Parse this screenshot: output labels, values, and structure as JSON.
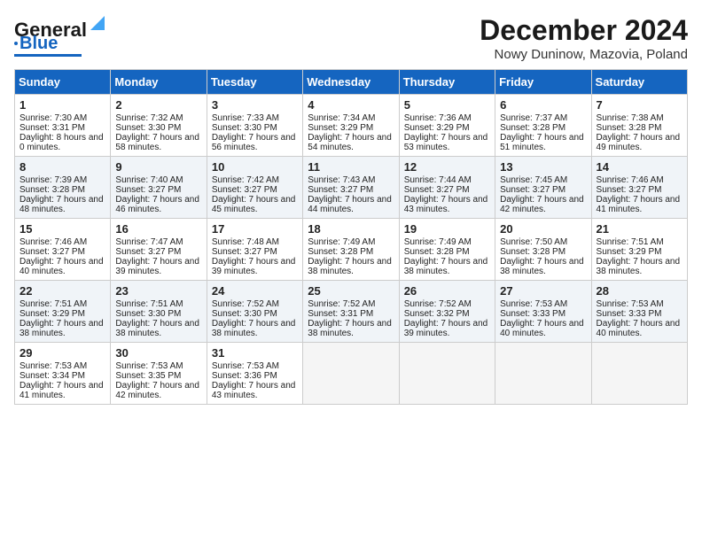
{
  "logo": {
    "line1": "General",
    "line2": "Blue"
  },
  "title": "December 2024",
  "location": "Nowy Duninow, Mazovia, Poland",
  "headers": [
    "Sunday",
    "Monday",
    "Tuesday",
    "Wednesday",
    "Thursday",
    "Friday",
    "Saturday"
  ],
  "weeks": [
    [
      {
        "num": "1",
        "sr": "7:30 AM",
        "ss": "3:31 PM",
        "dl": "8 hours and 0 minutes."
      },
      {
        "num": "2",
        "sr": "7:32 AM",
        "ss": "3:30 PM",
        "dl": "7 hours and 58 minutes."
      },
      {
        "num": "3",
        "sr": "7:33 AM",
        "ss": "3:30 PM",
        "dl": "7 hours and 56 minutes."
      },
      {
        "num": "4",
        "sr": "7:34 AM",
        "ss": "3:29 PM",
        "dl": "7 hours and 54 minutes."
      },
      {
        "num": "5",
        "sr": "7:36 AM",
        "ss": "3:29 PM",
        "dl": "7 hours and 53 minutes."
      },
      {
        "num": "6",
        "sr": "7:37 AM",
        "ss": "3:28 PM",
        "dl": "7 hours and 51 minutes."
      },
      {
        "num": "7",
        "sr": "7:38 AM",
        "ss": "3:28 PM",
        "dl": "7 hours and 49 minutes."
      }
    ],
    [
      {
        "num": "8",
        "sr": "7:39 AM",
        "ss": "3:28 PM",
        "dl": "7 hours and 48 minutes."
      },
      {
        "num": "9",
        "sr": "7:40 AM",
        "ss": "3:27 PM",
        "dl": "7 hours and 46 minutes."
      },
      {
        "num": "10",
        "sr": "7:42 AM",
        "ss": "3:27 PM",
        "dl": "7 hours and 45 minutes."
      },
      {
        "num": "11",
        "sr": "7:43 AM",
        "ss": "3:27 PM",
        "dl": "7 hours and 44 minutes."
      },
      {
        "num": "12",
        "sr": "7:44 AM",
        "ss": "3:27 PM",
        "dl": "7 hours and 43 minutes."
      },
      {
        "num": "13",
        "sr": "7:45 AM",
        "ss": "3:27 PM",
        "dl": "7 hours and 42 minutes."
      },
      {
        "num": "14",
        "sr": "7:46 AM",
        "ss": "3:27 PM",
        "dl": "7 hours and 41 minutes."
      }
    ],
    [
      {
        "num": "15",
        "sr": "7:46 AM",
        "ss": "3:27 PM",
        "dl": "7 hours and 40 minutes."
      },
      {
        "num": "16",
        "sr": "7:47 AM",
        "ss": "3:27 PM",
        "dl": "7 hours and 39 minutes."
      },
      {
        "num": "17",
        "sr": "7:48 AM",
        "ss": "3:27 PM",
        "dl": "7 hours and 39 minutes."
      },
      {
        "num": "18",
        "sr": "7:49 AM",
        "ss": "3:28 PM",
        "dl": "7 hours and 38 minutes."
      },
      {
        "num": "19",
        "sr": "7:49 AM",
        "ss": "3:28 PM",
        "dl": "7 hours and 38 minutes."
      },
      {
        "num": "20",
        "sr": "7:50 AM",
        "ss": "3:28 PM",
        "dl": "7 hours and 38 minutes."
      },
      {
        "num": "21",
        "sr": "7:51 AM",
        "ss": "3:29 PM",
        "dl": "7 hours and 38 minutes."
      }
    ],
    [
      {
        "num": "22",
        "sr": "7:51 AM",
        "ss": "3:29 PM",
        "dl": "7 hours and 38 minutes."
      },
      {
        "num": "23",
        "sr": "7:51 AM",
        "ss": "3:30 PM",
        "dl": "7 hours and 38 minutes."
      },
      {
        "num": "24",
        "sr": "7:52 AM",
        "ss": "3:30 PM",
        "dl": "7 hours and 38 minutes."
      },
      {
        "num": "25",
        "sr": "7:52 AM",
        "ss": "3:31 PM",
        "dl": "7 hours and 38 minutes."
      },
      {
        "num": "26",
        "sr": "7:52 AM",
        "ss": "3:32 PM",
        "dl": "7 hours and 39 minutes."
      },
      {
        "num": "27",
        "sr": "7:53 AM",
        "ss": "3:33 PM",
        "dl": "7 hours and 40 minutes."
      },
      {
        "num": "28",
        "sr": "7:53 AM",
        "ss": "3:33 PM",
        "dl": "7 hours and 40 minutes."
      }
    ],
    [
      {
        "num": "29",
        "sr": "7:53 AM",
        "ss": "3:34 PM",
        "dl": "7 hours and 41 minutes."
      },
      {
        "num": "30",
        "sr": "7:53 AM",
        "ss": "3:35 PM",
        "dl": "7 hours and 42 minutes."
      },
      {
        "num": "31",
        "sr": "7:53 AM",
        "ss": "3:36 PM",
        "dl": "7 hours and 43 minutes."
      },
      null,
      null,
      null,
      null
    ]
  ],
  "labels": {
    "sunrise": "Sunrise:",
    "sunset": "Sunset:",
    "daylight": "Daylight:"
  }
}
